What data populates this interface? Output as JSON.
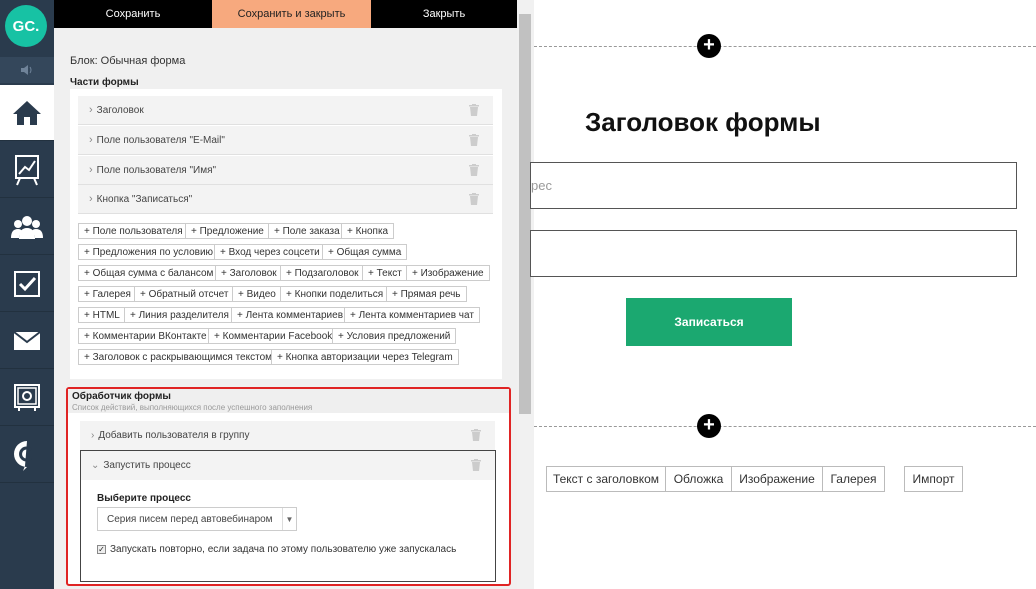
{
  "sidebar": {
    "logo_text": "GC.",
    "items": [
      {
        "icon": "home-icon"
      },
      {
        "icon": "chart-icon"
      },
      {
        "icon": "users-icon"
      },
      {
        "icon": "tasks-icon"
      },
      {
        "icon": "mail-icon"
      },
      {
        "icon": "safe-icon"
      },
      {
        "icon": "chat-icon"
      }
    ]
  },
  "toolbar": {
    "save": "Сохранить",
    "save_close": "Сохранить и закрыть",
    "close": "Закрыть"
  },
  "panel": {
    "block_title": "Блок: Обычная форма",
    "parts_title": "Части формы",
    "parts": [
      "Заголовок",
      "Поле пользователя \"E-Mail\"",
      "Поле пользователя \"Имя\"",
      "Кнопка \"Записаться\""
    ],
    "tags": [
      "+ Поле пользователя",
      "+ Предложение",
      "+ Поле заказа",
      "+ Кнопка",
      "+ Предложения по условию",
      "+ Вход через соцсети",
      "+ Общая сумма",
      "+ Общая сумма с балансом",
      "+ Заголовок",
      "+ Подзаголовок",
      "+ Текст",
      "+ Изображение",
      "+ Галерея",
      "+ Обратный отсчет",
      "+ Видео",
      "+ Кнопки поделиться",
      "+ Прямая речь",
      "+ HTML",
      "+ Линия разделителя",
      "+ Лента комментариев",
      "+ Лента комментариев чат",
      "+ Комментарии ВКонтакте",
      "+ Комментарии Facebook",
      "+ Условия предложений",
      "+ Заголовок с раскрывающимся текстом",
      "+ Кнопка авторизации через Telegram"
    ],
    "handler": {
      "title": "Обработчик формы",
      "subtitle": "Список действий, выполняющихся после успешного заполнения",
      "action1": "Добавить пользователя в группу",
      "action2": "Запустить процесс",
      "choose_label": "Выберите процесс",
      "process_value": "Серия писем перед автовебинаром",
      "repeat_label": "Запускать повторно, если задача по этому пользователю уже запускалась",
      "repeat_checked": true
    }
  },
  "preview": {
    "form_title": "Заголовок формы",
    "email_placeholder": "рес",
    "name_placeholder": "",
    "submit_label": "Записаться",
    "accent": "#1ba870",
    "add_blocks": [
      "Текст с заголовком",
      "Обложка",
      "Изображение",
      "Галерея"
    ],
    "import_label": "Импорт"
  }
}
